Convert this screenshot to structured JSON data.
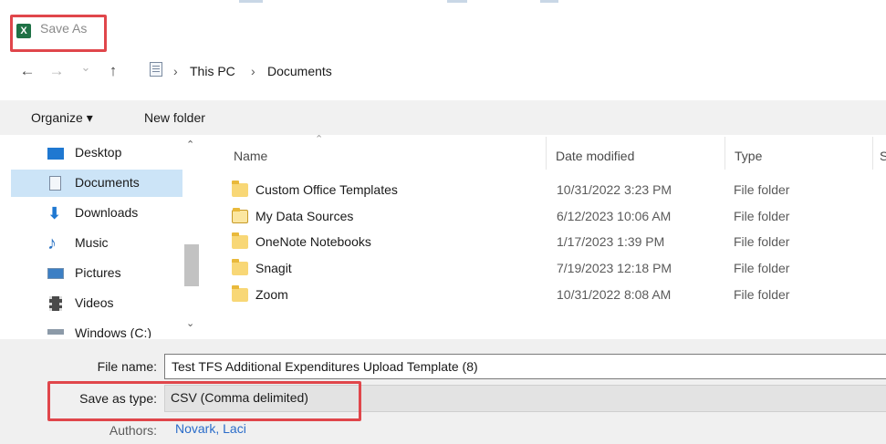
{
  "window": {
    "app_icon": "excel-icon",
    "app_icon_glyph": "X",
    "title": "Save As",
    "highlight_color": "#e0464b"
  },
  "navigation": {
    "back_glyph": "←",
    "forward_glyph": "→",
    "recent_glyph": "⌄",
    "up_glyph": "↑",
    "separator": "›",
    "breadcrumb": [
      "This PC",
      "Documents"
    ]
  },
  "toolbar": {
    "organize_label": "Organize ▾",
    "new_folder_label": "New folder"
  },
  "sidebar": {
    "items": [
      {
        "label": "Desktop",
        "icon": "desktop-icon",
        "selected": false
      },
      {
        "label": "Documents",
        "icon": "documents-icon",
        "selected": true
      },
      {
        "label": "Downloads",
        "icon": "downloads-icon",
        "selected": false
      },
      {
        "label": "Music",
        "icon": "music-icon",
        "selected": false
      },
      {
        "label": "Pictures",
        "icon": "pictures-icon",
        "selected": false
      },
      {
        "label": "Videos",
        "icon": "videos-icon",
        "selected": false
      },
      {
        "label": "Windows (C:)",
        "icon": "drive-icon",
        "selected": false
      }
    ]
  },
  "file_list": {
    "columns": [
      "Name",
      "Date modified",
      "Type",
      "S"
    ],
    "rows": [
      {
        "name": "Custom Office Templates",
        "date": "10/31/2022 3:23 PM",
        "type": "File folder",
        "icon": "folder-icon"
      },
      {
        "name": "My Data Sources",
        "date": "6/12/2023 10:06 AM",
        "type": "File folder",
        "icon": "data-sources-folder-icon"
      },
      {
        "name": "OneNote Notebooks",
        "date": "1/17/2023 1:39 PM",
        "type": "File folder",
        "icon": "folder-icon"
      },
      {
        "name": "Snagit",
        "date": "7/19/2023 12:18 PM",
        "type": "File folder",
        "icon": "folder-icon"
      },
      {
        "name": "Zoom",
        "date": "10/31/2022 8:08 AM",
        "type": "File folder",
        "icon": "folder-icon"
      }
    ]
  },
  "form": {
    "file_name_label": "File name:",
    "file_name_value": "Test TFS Additional Expenditures Upload Template (8)",
    "save_as_type_label": "Save as type:",
    "save_as_type_value": "CSV (Comma delimited)",
    "authors_label": "Authors:",
    "authors_value": "Novark, Laci"
  }
}
